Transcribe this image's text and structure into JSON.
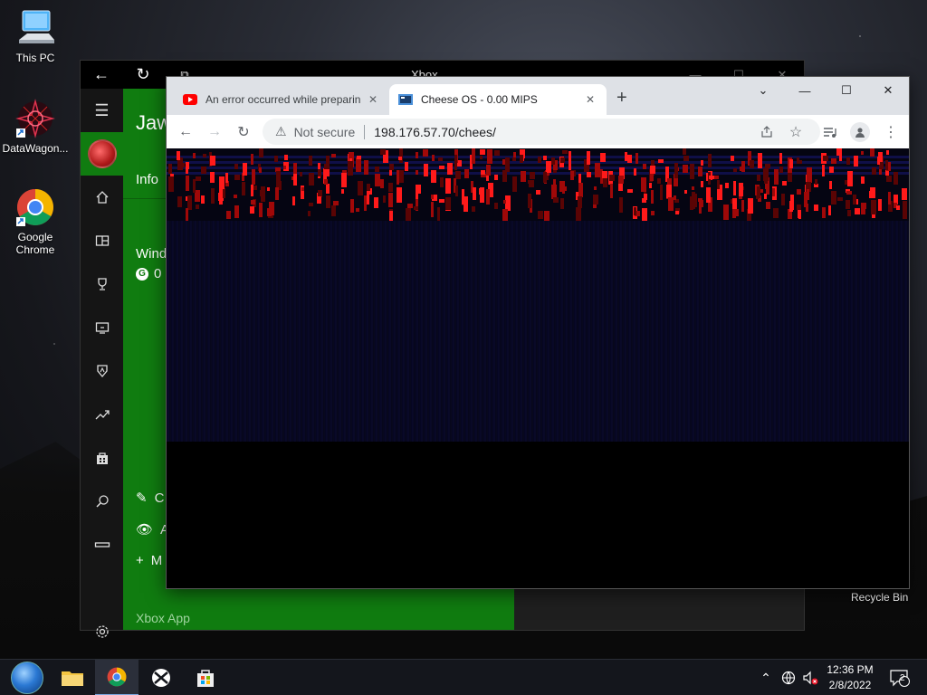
{
  "desktop": {
    "icons": [
      {
        "label": "This PC",
        "icon": "this-pc-icon"
      },
      {
        "label": "DataWagon...",
        "icon": "datawagon-icon"
      },
      {
        "label": "Google\nChrome",
        "icon": "chrome-icon"
      }
    ],
    "recycle_bin": "Recycle Bin"
  },
  "xbox": {
    "title": "Xbox",
    "name": "Jaw",
    "info_tab": "Info",
    "windows_text": "Wind",
    "gamerscore": "0",
    "actions": [
      {
        "icon": "pencil-icon",
        "label": "C"
      },
      {
        "icon": "eye-icon",
        "label": "A"
      },
      {
        "icon": "plus-icon",
        "label": "M"
      }
    ],
    "app_label": "Xbox App"
  },
  "chrome": {
    "tabs": [
      {
        "title": "An error occurred while preparing",
        "icon": "youtube-icon",
        "active": false
      },
      {
        "title": "Cheese OS - 0.00 MIPS",
        "icon": "cheese-os-icon",
        "active": true
      }
    ],
    "omnibox": {
      "security": "Not secure",
      "url": "198.176.57.70/chees/"
    }
  },
  "taskbar": {
    "time": "12:36 PM",
    "date": "2/8/2022",
    "notification_count": "2"
  },
  "colors": {
    "xbox_green": "#107c10",
    "taskbar": "#14161c",
    "chrome_tabbar": "#dee1e6"
  }
}
